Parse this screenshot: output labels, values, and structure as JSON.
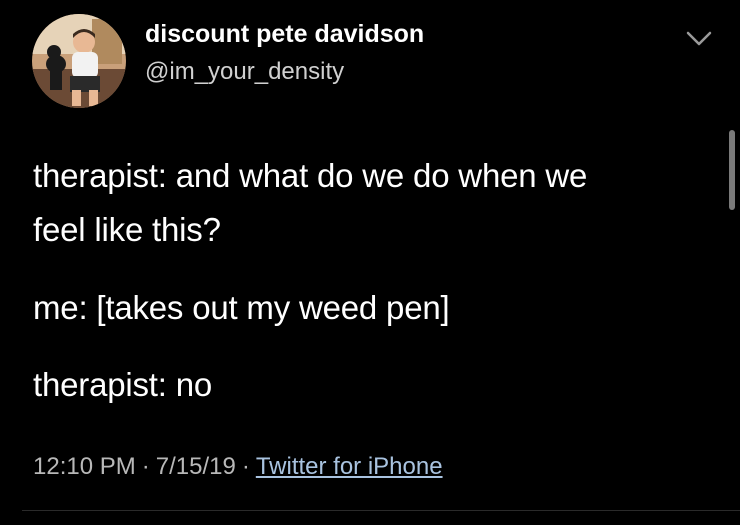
{
  "tweet": {
    "display_name": "discount pete davidson",
    "handle": "@im_your_density",
    "lines": [
      "therapist: and what do we do when we",
      "feel like this?",
      "me: [takes out my weed pen]",
      "therapist: no"
    ],
    "time": "12:10 PM",
    "date": "7/15/19",
    "separator": "·",
    "source": "Twitter for iPhone"
  },
  "icons": {
    "avatar": "profile-photo",
    "menu": "chevron-down-icon"
  }
}
